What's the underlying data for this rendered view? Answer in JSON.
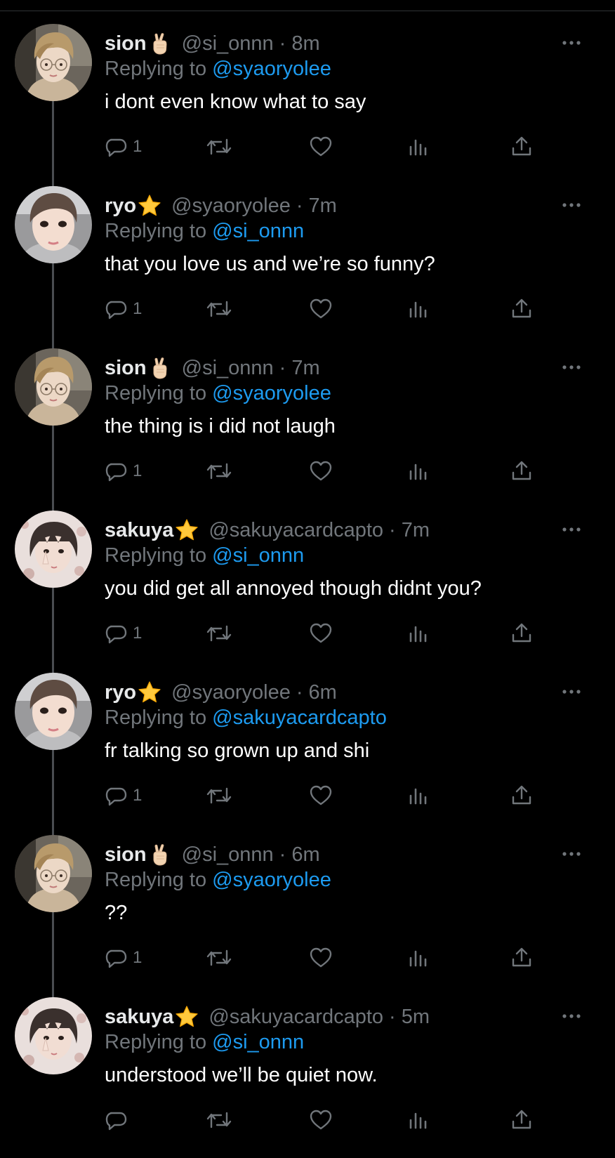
{
  "tweets": [
    {
      "name": "sion",
      "emoji": "crossed-fingers-emoji",
      "handle": "@si_onnn",
      "dot": "·",
      "time": "8m",
      "replying_prefix": "Replying to ",
      "replying_to": "@syaoryolee",
      "text": "i dont even know what to say",
      "reply_count": "1",
      "avatar": "sion"
    },
    {
      "name": "ryo",
      "emoji": "star-emoji",
      "handle": "@syaoryolee",
      "dot": "·",
      "time": "7m",
      "replying_prefix": "Replying to ",
      "replying_to": "@si_onnn",
      "text": "that you love us and we’re so funny?",
      "reply_count": "1",
      "avatar": "ryo"
    },
    {
      "name": "sion",
      "emoji": "crossed-fingers-emoji",
      "handle": "@si_onnn",
      "dot": "·",
      "time": "7m",
      "replying_prefix": "Replying to ",
      "replying_to": "@syaoryolee",
      "text": "the thing is i did not laugh",
      "reply_count": "1",
      "avatar": "sion"
    },
    {
      "name": "sakuya",
      "emoji": "star-emoji",
      "handle": "@sakuyacardcapto",
      "dot": "·",
      "time": "7m",
      "replying_prefix": "Replying to ",
      "replying_to": "@si_onnn",
      "text": "you did get all annoyed though didnt you?",
      "reply_count": "1",
      "avatar": "sakuya"
    },
    {
      "name": "ryo",
      "emoji": "star-emoji",
      "handle": "@syaoryolee",
      "dot": "·",
      "time": "6m",
      "replying_prefix": "Replying to ",
      "replying_to": "@sakuyacardcapto",
      "text": "fr talking so grown up and shi",
      "reply_count": "1",
      "avatar": "ryo"
    },
    {
      "name": "sion",
      "emoji": "crossed-fingers-emoji",
      "handle": "@si_onnn",
      "dot": "·",
      "time": "6m",
      "replying_prefix": "Replying to ",
      "replying_to": "@syaoryolee",
      "text": "??",
      "reply_count": "1",
      "avatar": "sion"
    },
    {
      "name": "sakuya",
      "emoji": "star-emoji",
      "handle": "@sakuyacardcapto",
      "dot": "·",
      "time": "5m",
      "replying_prefix": "Replying to ",
      "replying_to": "@si_onnn",
      "text": "understood we’ll be quiet now.",
      "reply_count": "",
      "avatar": "sakuya"
    }
  ],
  "icons": {
    "reply": "reply-icon",
    "retweet": "retweet-icon",
    "like": "heart-icon",
    "views": "views-icon",
    "share": "share-icon",
    "more": "more-icon"
  },
  "colors": {
    "background": "#000000",
    "text": "#e7e9ea",
    "secondary": "#71767b",
    "link": "#1d9bf0",
    "thread_line": "#4a4d51"
  }
}
